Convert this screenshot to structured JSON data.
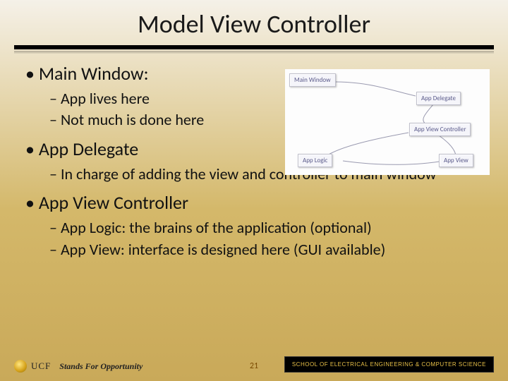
{
  "title": "Model View Controller",
  "bullets": [
    {
      "label": "Main Window:",
      "sub": [
        "App lives here",
        "Not much is done here"
      ]
    },
    {
      "label": "App Delegate",
      "sub": [
        "In charge of adding the view and controller to main window"
      ]
    },
    {
      "label": "App View Controller",
      "sub": [
        "App Logic: the brains of the application  (optional)",
        "App View: interface is designed here (GUI available)"
      ]
    }
  ],
  "diagram": {
    "nodes": {
      "main_window": "Main Window",
      "app_delegate": "App Delegate",
      "app_view_controller": "App View Controller",
      "app_logic": "App Logic",
      "app_view": "App View"
    }
  },
  "footer": {
    "ucf": "UCF",
    "tagline": "Stands For Opportunity",
    "page": "21",
    "dept": "SCHOOL OF ELECTRICAL ENGINEERING & COMPUTER SCIENCE"
  }
}
